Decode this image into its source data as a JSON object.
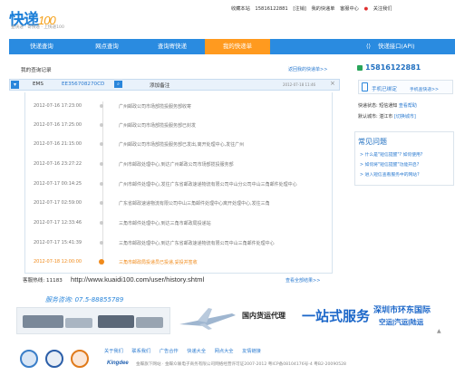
{
  "header": {
    "logo_main": "快递",
    "logo_num": "100",
    "slogan": "查快递 · 寄快递 · 上快递100",
    "top_links": [
      "收藏本站",
      "15816122881",
      "[注销]",
      "我的快递单",
      "客服中心",
      "关注我们"
    ]
  },
  "nav": {
    "items": [
      "快递查询",
      "网点查询",
      "查询寄快递",
      "我的快递单",
      "快递接口(API)"
    ]
  },
  "records": {
    "title": "我的查询记录",
    "link": "返回我的快递单>>",
    "row": {
      "company": "EMS",
      "number": "EE356708270CD",
      "remark": "添加备注",
      "time": "2012-07-18 11:46",
      "close": "×"
    },
    "events": [
      {
        "time": "2012-07-16 17:23:00",
        "text": "广州邮政公司市场部揽投服务部收寄"
      },
      {
        "time": "2012-07-16 17:25:00",
        "text": "广州邮政公司市场部揽投服务部已封发"
      },
      {
        "time": "2012-07-16 21:15:00",
        "text": "广州邮政公司市场部揽投服务部已发出,离开处理中心,发往广州"
      },
      {
        "time": "2012-07-16 23:27:22",
        "text": "广州市邮政处理中心,到达广州邮政公司市场部揽投服务部"
      },
      {
        "time": "2012-07-17 00:14:25",
        "text": "广州市邮件处理中心,发往广东省邮政速递物流有限公司中山分公司中山三角邮件处理中心"
      },
      {
        "time": "2012-07-17 02:59:00",
        "text": "广东省邮政速递物流有限公司中山三角邮件处理中心离开处理中心,发往三角"
      },
      {
        "time": "2012-07-17 12:33:46",
        "text": "三角市邮件处理中心,到达三角市邮政局投递站"
      },
      {
        "time": "2012-07-17 15:41:39",
        "text": "三角市邮政处理中心,到达广东省邮政速递物流有限公司中山三角邮件处理中心"
      },
      {
        "time": "2012-07-18 12:00:00",
        "text": "三角市邮政局投递员已投递,妥投并签收"
      }
    ]
  },
  "bottom": {
    "hotline_label": "客服热线: 11183",
    "url": "http://www.kuaidi100.com/user/history.shtml",
    "more": "查看全部结果>>",
    "service": "服务咨询: 07.5-88855789"
  },
  "sidebar": {
    "phone": "15816122881",
    "bind_text": "手机已绑定",
    "bind_link": "手机查快递>>",
    "msg1_label": "快递状态:",
    "msg1_value": "短信通知",
    "msg1_link": "查看帮助",
    "msg2_label": "默认城市:",
    "msg2_value": "湛江市",
    "msg2_link": "[切换城市]",
    "faq_title": "常见问题",
    "faqs": [
      "> 什么是\"短信提醒\"? 如何使用?",
      "> 如何将\"短信提醒\"功能开启?",
      "> 进入短信查看服务中的网站?"
    ]
  },
  "banner": {
    "a": "国内货运代理",
    "b": "一站式服务",
    "c": "深圳市环东国际",
    "d": "空运|汽运|陆运",
    "arrow": "▲"
  },
  "footer": {
    "links": [
      "关于我们",
      "联系我们",
      "广告合作",
      "快递大全",
      "网点大全",
      "友情链接"
    ],
    "kingdee": "Kingdee",
    "copyright": "金蝶旗下网站 · 金蝶众联电子商务有限公司网络经营许可证2007-2012 粤ICP备08104176号-4 粤B2-20090528"
  },
  "colors": {
    "primary": "#2a8be0",
    "active": "#ff9a1f",
    "link": "#2a7ad0"
  }
}
